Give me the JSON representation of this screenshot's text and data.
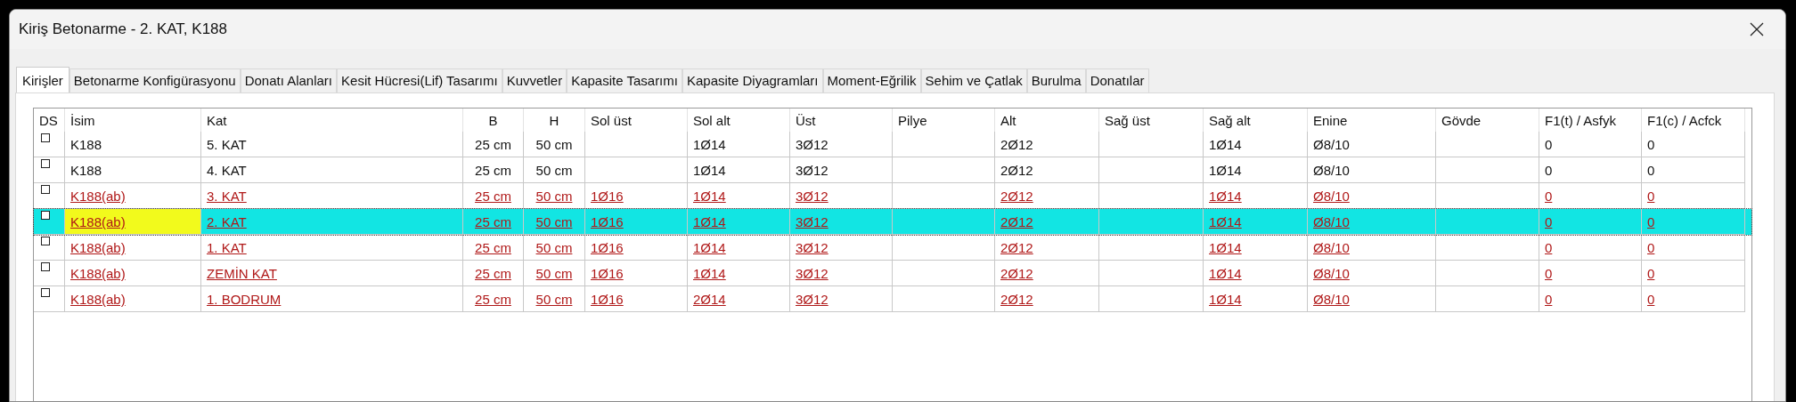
{
  "window": {
    "title": "Kiriş Betonarme - 2. KAT, K188"
  },
  "tabs": [
    {
      "label": "Kirişler",
      "selected": true
    },
    {
      "label": "Betonarme Konfigürasyonu",
      "selected": false
    },
    {
      "label": "Donatı Alanları",
      "selected": false
    },
    {
      "label": "Kesit Hücresi(Lif) Tasarımı",
      "selected": false
    },
    {
      "label": "Kuvvetler",
      "selected": false
    },
    {
      "label": "Kapasite Tasarımı",
      "selected": false
    },
    {
      "label": "Kapasite Diyagramları",
      "selected": false
    },
    {
      "label": "Moment-Eğrilik",
      "selected": false
    },
    {
      "label": "Sehim ve Çatlak",
      "selected": false
    },
    {
      "label": "Burulma",
      "selected": false
    },
    {
      "label": "Donatılar",
      "selected": false
    }
  ],
  "table": {
    "columns": [
      "DS",
      "İsim",
      "Kat",
      "B",
      "H",
      "Sol üst",
      "Sol alt",
      "Üst",
      "Pilye",
      "Alt",
      "Sağ üst",
      "Sağ alt",
      "Enine",
      "Gövde",
      "F1(t) / Asfyk",
      "F1(c) / Acfck"
    ],
    "rows": [
      {
        "checked": false,
        "selected": false,
        "linked": false,
        "cells": [
          "",
          "K188",
          "5. KAT",
          "25 cm",
          "50 cm",
          "",
          "1Ø14",
          "3Ø12",
          "",
          "2Ø12",
          "",
          "1Ø14",
          "Ø8/10",
          "",
          "0",
          "0"
        ]
      },
      {
        "checked": false,
        "selected": false,
        "linked": false,
        "cells": [
          "",
          "K188",
          "4. KAT",
          "25 cm",
          "50 cm",
          "",
          "1Ø14",
          "3Ø12",
          "",
          "2Ø12",
          "",
          "1Ø14",
          "Ø8/10",
          "",
          "0",
          "0"
        ]
      },
      {
        "checked": false,
        "selected": false,
        "linked": true,
        "cells": [
          "",
          "K188(ab)",
          "3. KAT",
          "25 cm",
          "50 cm",
          "1Ø16",
          "1Ø14",
          "3Ø12",
          "",
          "2Ø12",
          "",
          "1Ø14",
          "Ø8/10",
          "",
          "0",
          "0"
        ]
      },
      {
        "checked": false,
        "selected": true,
        "linked": true,
        "cells": [
          "",
          "K188(ab)",
          "2. KAT",
          "25 cm",
          "50 cm",
          "1Ø16",
          "1Ø14",
          "3Ø12",
          "",
          "2Ø12",
          "",
          "1Ø14",
          "Ø8/10",
          "",
          "0",
          "0"
        ]
      },
      {
        "checked": false,
        "selected": false,
        "linked": true,
        "cells": [
          "",
          "K188(ab)",
          "1. KAT",
          "25 cm",
          "50 cm",
          "1Ø16",
          "1Ø14",
          "3Ø12",
          "",
          "2Ø12",
          "",
          "1Ø14",
          "Ø8/10",
          "",
          "0",
          "0"
        ]
      },
      {
        "checked": false,
        "selected": false,
        "linked": true,
        "cells": [
          "",
          "K188(ab)",
          "ZEMİN KAT",
          "25 cm",
          "50 cm",
          "1Ø16",
          "1Ø14",
          "3Ø12",
          "",
          "2Ø12",
          "",
          "1Ø14",
          "Ø8/10",
          "",
          "0",
          "0"
        ]
      },
      {
        "checked": false,
        "selected": false,
        "linked": true,
        "cells": [
          "",
          "K188(ab)",
          "1. BODRUM",
          "25 cm",
          "50 cm",
          "1Ø16",
          "2Ø14",
          "3Ø12",
          "",
          "2Ø12",
          "",
          "1Ø14",
          "Ø8/10",
          "",
          "0",
          "0"
        ]
      }
    ]
  }
}
